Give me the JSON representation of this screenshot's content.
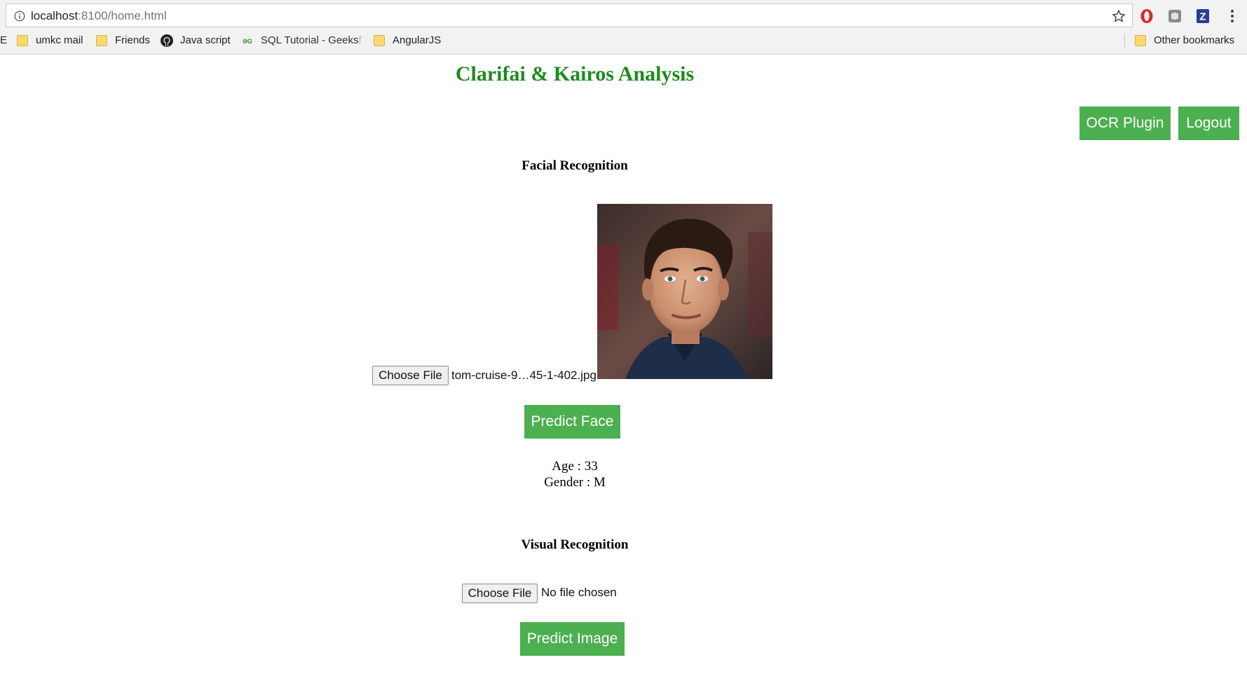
{
  "browser": {
    "url_host": "localhost",
    "url_path": ":8100/home.html",
    "bookmarks": {
      "cut_off": "E",
      "umkc_mail": "umkc mail",
      "friends": "Friends",
      "java_script": "Java script",
      "sql_tutorial_main": "SQL Tutorial - Geeks",
      "sql_tutorial_fade": "f",
      "angularjs": "AngularJS",
      "other_bookmarks": "Other bookmarks"
    },
    "extensions": {
      "z_label": "Z"
    },
    "icons": {
      "info": "info-icon",
      "star": "star-icon",
      "opera": "opera-icon",
      "menu": "menu-icon",
      "github": "github-icon",
      "folder": "folder-icon",
      "geeksforgeeks": "gfg-icon"
    }
  },
  "page": {
    "title": "Clarifai & Kairos Analysis",
    "title_color": "#1e8a1e",
    "accent_color": "#4caf50",
    "header_buttons": {
      "ocr": "OCR Plugin",
      "logout": "Logout"
    },
    "facial": {
      "heading": "Facial Recognition",
      "choose_file": "Choose File",
      "file_name": "tom-cruise-9…45-1-402.jpg",
      "predict_button": "Predict Face",
      "age_line": "Age : 33",
      "gender_line": "Gender : M"
    },
    "visual": {
      "heading": "Visual Recognition",
      "choose_file": "Choose File",
      "file_name": "No file chosen",
      "predict_button": "Predict Image"
    }
  }
}
